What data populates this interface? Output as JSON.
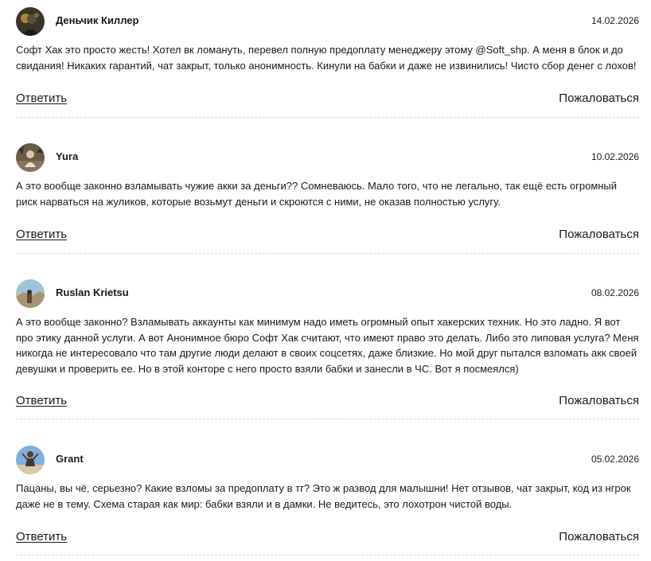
{
  "comments": [
    {
      "author": "Деньчик Киллер",
      "date": "14.02.2026",
      "text": "Софт Хак это просто жесть! Хотел вк ломануть, перевел полную предоплату менеджеру этому @Soft_shp. А меня в блок и до свидания! Никаких гарантий, чат закрыт, только анонимность. Кинули на бабки и даже не извинились! Чисто сбор денег с лохов!",
      "reply_label": "Ответить",
      "complain_label": "Пожаловаться",
      "avatar_icon": "user-avatar-dark"
    },
    {
      "author": "Yura",
      "date": "10.02.2026",
      "text": "А это вообще законно взламывать чужие акки за деньги?? Сомневаюсь. Мало того, что не легально, так ещё есть огромный риск нарваться на жуликов, которые возьмут деньги и скроются с ними, не оказав полностью услугу.",
      "reply_label": "Ответить",
      "complain_label": "Пожаловаться",
      "avatar_icon": "user-avatar-brown"
    },
    {
      "author": "Ruslan Krietsu",
      "date": "08.02.2026",
      "text": "А это вообще законно? Взламывать аккаунты как минимум надо иметь огромный опыт хакерских техник. Но это ладно. Я вот про этику данной услуги. А вот Анонимное бюро Софт Хак считают, что имеют право это делать. Либо это липовая услуга? Меня никогда не интересовало что там другие люди делают в своих соцсетях, даже близкие. Но мой друг пытался взломать акк своей девушки и проверить ее. Но в этой конторе с него просто взяли бабки и занесли в ЧС. Вот я посмеялся)",
      "reply_label": "Ответить",
      "complain_label": "Пожаловаться",
      "avatar_icon": "user-avatar-landscape"
    },
    {
      "author": "Grant",
      "date": "05.02.2026",
      "text": "Пацаны, вы чё, серьезно? Какие взломы за предоплату в тг? Это ж развод для малышни! Нет отзывов, чат закрыт, код из нгрок даже не в тему. Схема старая как мир: бабки взяли и в дамки. Не ведитесь, это лохотрон чистой воды.",
      "reply_label": "Ответить",
      "complain_label": "Пожаловаться",
      "avatar_icon": "user-avatar-sky"
    }
  ]
}
